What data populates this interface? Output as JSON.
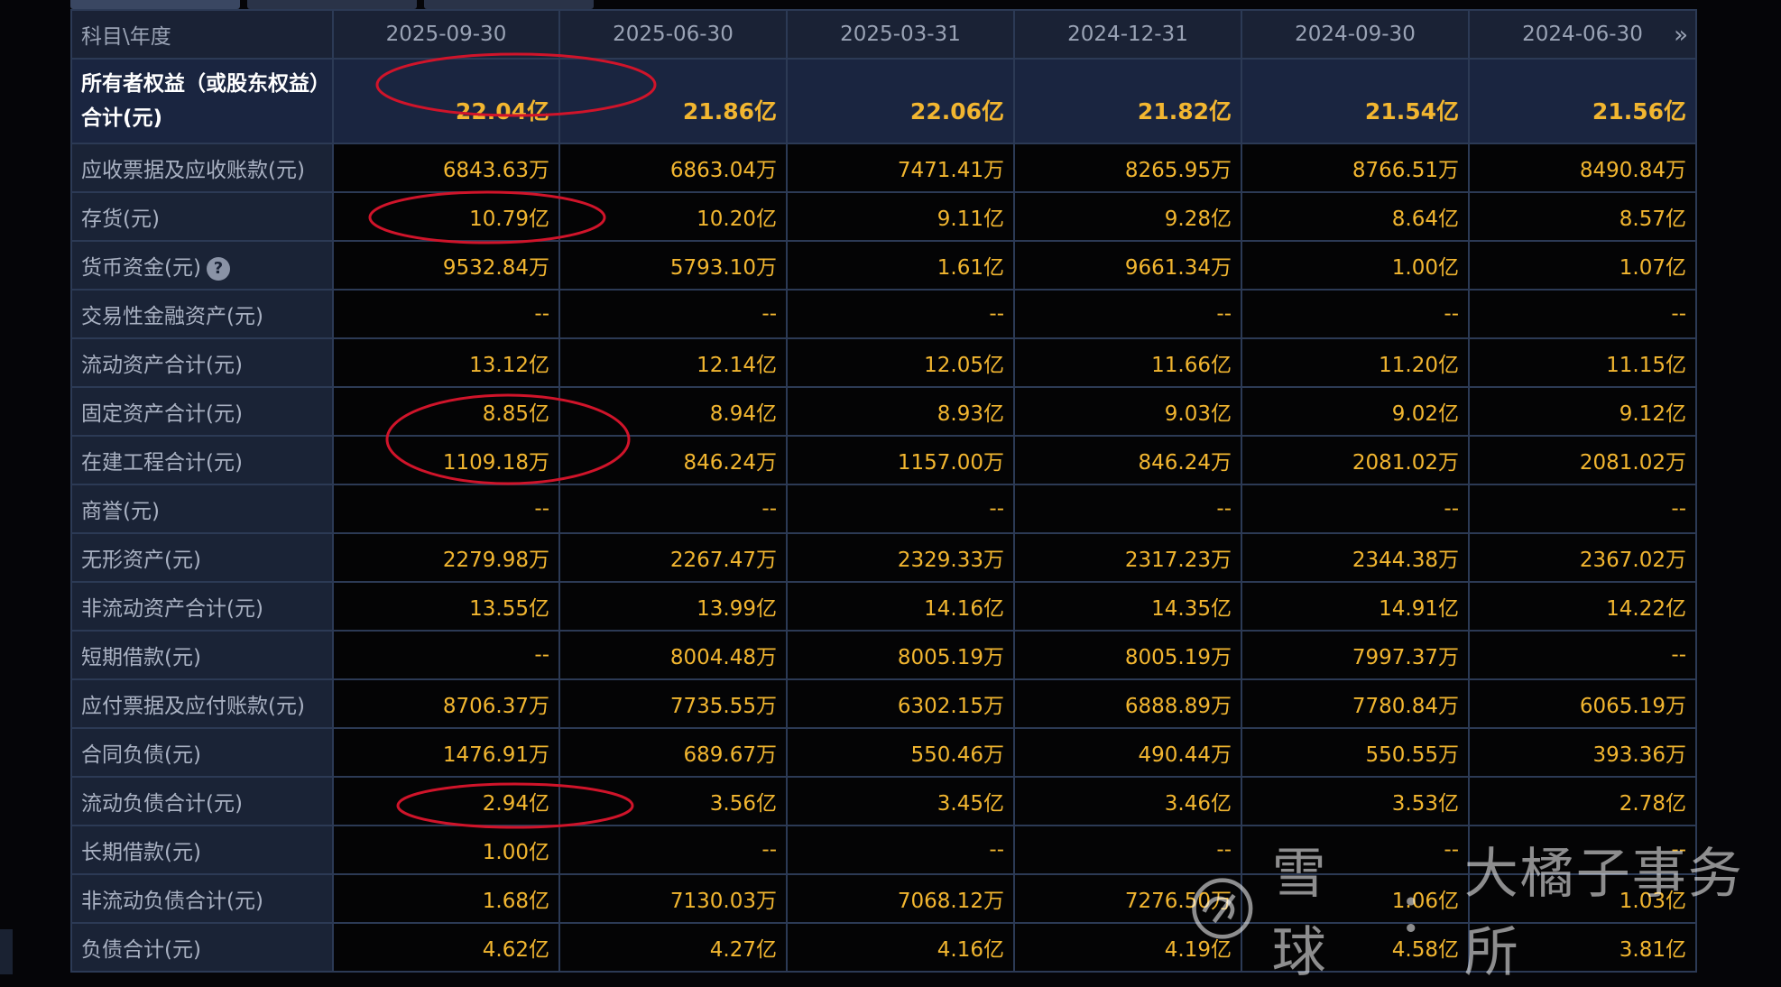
{
  "colors": {
    "value_text": "#f2b630",
    "annotation": "#d0142a",
    "header_bg": "#1a2235",
    "grid": "#2c3a55"
  },
  "table": {
    "corner_label": "科目\\年度",
    "columns": [
      "2025-09-30",
      "2025-06-30",
      "2025-03-31",
      "2024-12-31",
      "2024-09-30",
      "2024-06-30"
    ],
    "more_icon": "double-chevron-right-icon",
    "rows": [
      {
        "label": "所有者权益（或股东权益）合计(元)",
        "values": [
          "22.04亿",
          "21.86亿",
          "22.06亿",
          "21.82亿",
          "21.54亿",
          "21.56亿"
        ]
      },
      {
        "label": "应收票据及应收账款(元)",
        "values": [
          "6843.63万",
          "6863.04万",
          "7471.41万",
          "8265.95万",
          "8766.51万",
          "8490.84万"
        ]
      },
      {
        "label": "存货(元)",
        "values": [
          "10.79亿",
          "10.20亿",
          "9.11亿",
          "9.28亿",
          "8.64亿",
          "8.57亿"
        ]
      },
      {
        "label": "货币资金(元)",
        "help_icon": "question-circle-icon",
        "help_glyph": "?",
        "values": [
          "9532.84万",
          "5793.10万",
          "1.61亿",
          "9661.34万",
          "1.00亿",
          "1.07亿"
        ]
      },
      {
        "label": "交易性金融资产(元)",
        "values": [
          "--",
          "--",
          "--",
          "--",
          "--",
          "--"
        ]
      },
      {
        "label": "流动资产合计(元)",
        "values": [
          "13.12亿",
          "12.14亿",
          "12.05亿",
          "11.66亿",
          "11.20亿",
          "11.15亿"
        ]
      },
      {
        "label": "固定资产合计(元)",
        "values": [
          "8.85亿",
          "8.94亿",
          "8.93亿",
          "9.03亿",
          "9.02亿",
          "9.12亿"
        ]
      },
      {
        "label": "在建工程合计(元)",
        "values": [
          "1109.18万",
          "846.24万",
          "1157.00万",
          "846.24万",
          "2081.02万",
          "2081.02万"
        ]
      },
      {
        "label": "商誉(元)",
        "values": [
          "--",
          "--",
          "--",
          "--",
          "--",
          "--"
        ]
      },
      {
        "label": "无形资产(元)",
        "values": [
          "2279.98万",
          "2267.47万",
          "2329.33万",
          "2317.23万",
          "2344.38万",
          "2367.02万"
        ]
      },
      {
        "label": "非流动资产合计(元)",
        "values": [
          "13.55亿",
          "13.99亿",
          "14.16亿",
          "14.35亿",
          "14.91亿",
          "14.22亿"
        ]
      },
      {
        "label": "短期借款(元)",
        "values": [
          "--",
          "8004.48万",
          "8005.19万",
          "8005.19万",
          "7997.37万",
          "--"
        ]
      },
      {
        "label": "应付票据及应付账款(元)",
        "values": [
          "8706.37万",
          "7735.55万",
          "6302.15万",
          "6888.89万",
          "7780.84万",
          "6065.19万"
        ]
      },
      {
        "label": "合同负债(元)",
        "values": [
          "1476.91万",
          "689.67万",
          "550.46万",
          "490.44万",
          "550.55万",
          "393.36万"
        ]
      },
      {
        "label": "流动负债合计(元)",
        "values": [
          "2.94亿",
          "3.56亿",
          "3.45亿",
          "3.46亿",
          "3.53亿",
          "2.78亿"
        ]
      },
      {
        "label": "长期借款(元)",
        "values": [
          "1.00亿",
          "--",
          "--",
          "--",
          "--",
          "--"
        ]
      },
      {
        "label": "非流动负债合计(元)",
        "values": [
          "1.68亿",
          "7130.03万",
          "7068.12万",
          "7276.50万",
          "1.06亿",
          "1.03亿"
        ]
      },
      {
        "label": "负债合计(元)",
        "values": [
          "4.62亿",
          "4.27亿",
          "4.16亿",
          "4.19亿",
          "4.58亿",
          "3.81亿"
        ]
      }
    ]
  },
  "watermark": {
    "logo_icon": "snowball-logo-icon",
    "brand": "雪球",
    "separator": "：",
    "author": "大橘子事务所"
  }
}
